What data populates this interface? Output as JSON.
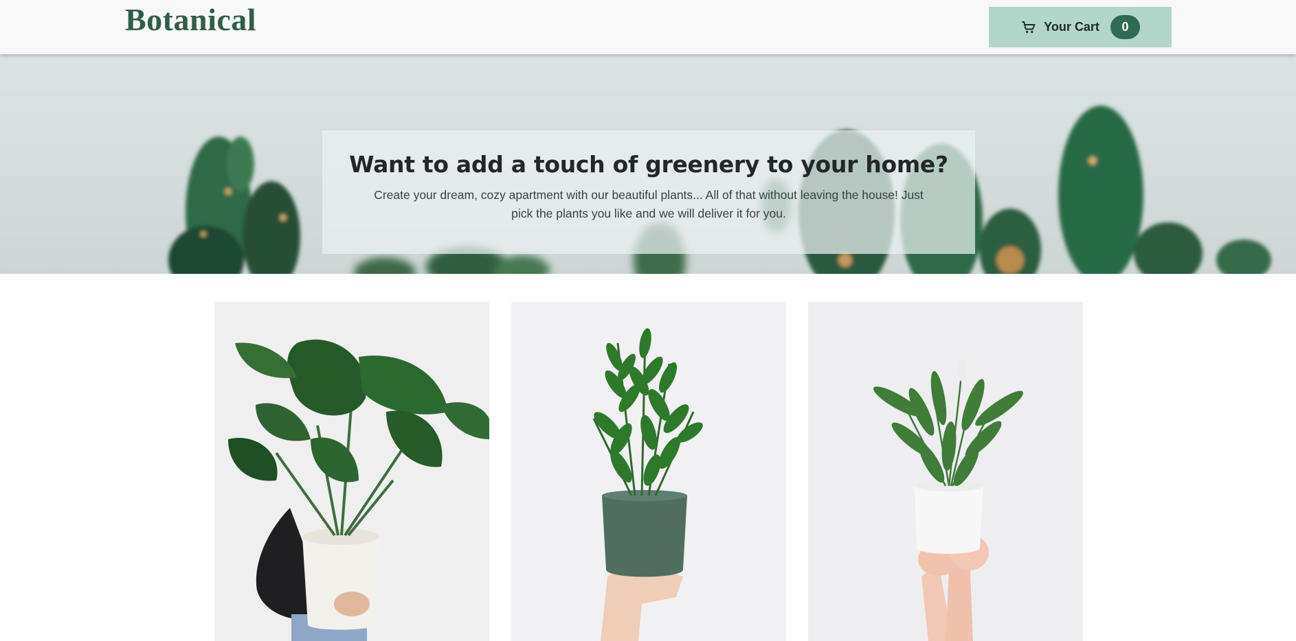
{
  "header": {
    "logo": "Botanical",
    "cart": {
      "label": "Your Cart",
      "count": "0",
      "icon": "shopping-cart-icon"
    }
  },
  "hero": {
    "title": "Want to add a touch of greenery to your home?",
    "text": "Create your dream, cozy apartment with our beautiful plants... All of that without leaving the house! Just pick the plants you like and we will deliver it for you."
  },
  "products": [
    {
      "image": "monstera-plant-photo"
    },
    {
      "image": "zz-plant-photo"
    },
    {
      "image": "peace-lily-photo"
    }
  ],
  "colors": {
    "brand": "#2f5e4b",
    "cart_button": "#b2d6c9",
    "badge": "#2f6a54",
    "header_bg": "#f8f8f8"
  }
}
